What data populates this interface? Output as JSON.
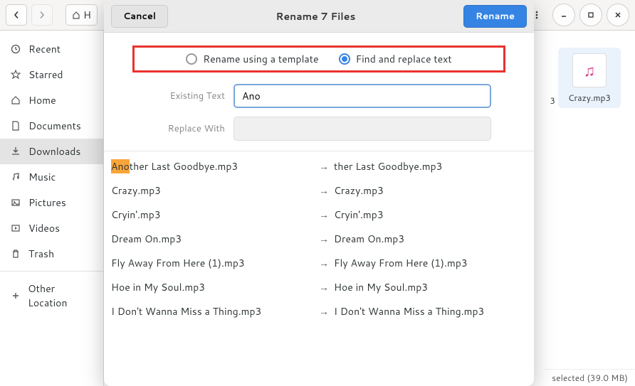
{
  "toolbar": {
    "back_icon": "back",
    "forward_icon": "forward",
    "home_label": "H"
  },
  "sidebar": {
    "items": [
      {
        "icon": "clock",
        "label": "Recent"
      },
      {
        "icon": "star",
        "label": "Starred"
      },
      {
        "icon": "home",
        "label": "Home"
      },
      {
        "icon": "doc",
        "label": "Documents"
      },
      {
        "icon": "down",
        "label": "Downloads"
      },
      {
        "icon": "music",
        "label": "Music"
      },
      {
        "icon": "pic",
        "label": "Pictures"
      },
      {
        "icon": "video",
        "label": "Videos"
      },
      {
        "icon": "trash",
        "label": "Trash"
      }
    ],
    "other_label": "Other Location"
  },
  "bg": {
    "partial_ext": "3",
    "tile_name": "Crazy.mp3",
    "status": "selected  (39.0 MB)"
  },
  "dialog": {
    "cancel": "Cancel",
    "title": "Rename 7 Files",
    "rename": "Rename",
    "mode_template": "Rename using a template",
    "mode_replace": "Find and replace text",
    "existing_label": "Existing Text",
    "existing_value": "Ano",
    "replace_label": "Replace With",
    "replace_value": "",
    "highlight": "Ano",
    "rows": [
      {
        "old_pre": "",
        "old_match": "Ano",
        "old_post": "ther Last Goodbye.mp3",
        "new": "ther Last Goodbye.mp3"
      },
      {
        "old_pre": "Crazy.mp3",
        "old_match": "",
        "old_post": "",
        "new": "Crazy.mp3"
      },
      {
        "old_pre": "Cryin'.mp3",
        "old_match": "",
        "old_post": "",
        "new": "Cryin'.mp3"
      },
      {
        "old_pre": "Dream On.mp3",
        "old_match": "",
        "old_post": "",
        "new": "Dream On.mp3"
      },
      {
        "old_pre": "Fly Away From Here (1).mp3",
        "old_match": "",
        "old_post": "",
        "new": "Fly Away From Here (1).mp3"
      },
      {
        "old_pre": "Hoe in My Soul.mp3",
        "old_match": "",
        "old_post": "",
        "new": "Hoe in My Soul.mp3"
      },
      {
        "old_pre": "I Don't Wanna Miss a Thing.mp3",
        "old_match": "",
        "old_post": "",
        "new": "I Don't Wanna Miss a Thing.mp3"
      }
    ]
  }
}
